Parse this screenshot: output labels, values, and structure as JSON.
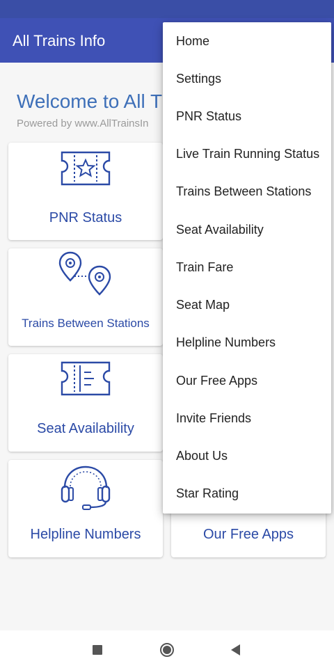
{
  "app": {
    "title": "All Trains Info"
  },
  "welcome": {
    "heading": "Welcome to All T",
    "powered_by": "Powered by www.AllTrainsIn"
  },
  "cards": [
    {
      "label": "PNR Status",
      "icon": "ticket-star-icon"
    },
    {
      "label": "Trains Between Stations",
      "icon": "route-pins-icon"
    },
    {
      "label": "Seat Availability",
      "icon": "ticket-seat-icon"
    },
    {
      "label": "Helpline Numbers",
      "icon": "headset-icon"
    },
    {
      "label": "Our Free Apps",
      "icon": "apps-icon"
    }
  ],
  "menu": {
    "items": [
      "Home",
      "Settings",
      "PNR Status",
      "Live Train Running Status",
      "Trains Between Stations",
      "Seat Availability",
      "Train Fare",
      "Seat Map",
      "Helpline Numbers",
      "Our Free Apps",
      "Invite Friends",
      "About Us",
      "Star Rating"
    ]
  },
  "navigation": {
    "buttons": [
      "recent-apps-icon",
      "home-icon",
      "back-icon"
    ]
  },
  "colors": {
    "app_bar": "#3f51b5",
    "accent_text": "#2b4aa6",
    "welcome_text": "#3d6fb8"
  }
}
